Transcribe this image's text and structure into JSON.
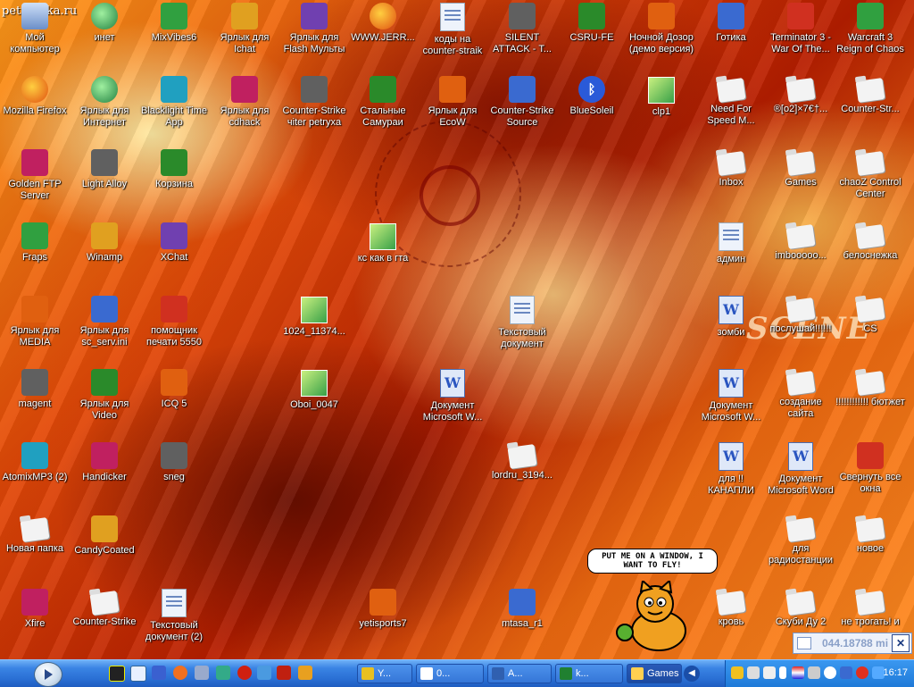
{
  "brand": "petryshka.ru",
  "wallpaper_text": "SCENE",
  "icons": [
    {
      "label": "Мой компьютер",
      "type": "computer"
    },
    {
      "label": "инет",
      "type": "net"
    },
    {
      "label": "MixVibes6",
      "type": "app"
    },
    {
      "label": "Ярлык для Ichat",
      "type": "app"
    },
    {
      "label": "Ярлык для Flash Мульты",
      "type": "app"
    },
    {
      "label": "WWW.JERR...",
      "type": "firefox"
    },
    {
      "label": "коды на counter-straik",
      "type": "doc"
    },
    {
      "label": "SILENT ATTACK - T...",
      "type": "app"
    },
    {
      "label": "CSRU-FE",
      "type": "app"
    },
    {
      "label": "Ночной Дозор (демо версия)",
      "type": "app"
    },
    {
      "label": "Готика",
      "type": "app"
    },
    {
      "label": "Terminator 3 - War Of The...",
      "type": "app"
    },
    {
      "label": "Warcraft 3 Reign of Chaos",
      "type": "app"
    },
    {
      "label": "Mozilla Firefox",
      "type": "firefox"
    },
    {
      "label": "Ярлык для Интернет",
      "type": "net"
    },
    {
      "label": "Blacklight Time App",
      "type": "app"
    },
    {
      "label": "Ярлык для cdhack",
      "type": "app"
    },
    {
      "label": "Counter-Strike чiter petryxa",
      "type": "app"
    },
    {
      "label": "Стальные Самураи",
      "type": "app"
    },
    {
      "label": "Ярлык для EcoW",
      "type": "app"
    },
    {
      "label": "Counter-Strike Source",
      "type": "app"
    },
    {
      "label": "BlueSoleil",
      "type": "bluetooth"
    },
    {
      "label": "clp1",
      "type": "img"
    },
    {
      "label": "Need For Speed M...",
      "type": "folder"
    },
    {
      "label": "®[o2]×7€†...",
      "type": "folder"
    },
    {
      "label": "Counter-Str...",
      "type": "folder"
    },
    {
      "label": "Golden FTP Server",
      "type": "app"
    },
    {
      "label": "Light Alloy",
      "type": "app"
    },
    {
      "label": "Корзина",
      "type": "app"
    },
    {
      "label": "Inbox",
      "type": "folder"
    },
    {
      "label": "Games",
      "type": "folder"
    },
    {
      "label": "chaoZ Control Center",
      "type": "folder"
    },
    {
      "label": "Fraps",
      "type": "app"
    },
    {
      "label": "Winamp",
      "type": "app"
    },
    {
      "label": "XChat",
      "type": "app"
    },
    {
      "label": "кс как в гта",
      "type": "img"
    },
    {
      "label": "админ",
      "type": "doc"
    },
    {
      "label": "imbooooo...",
      "type": "folder"
    },
    {
      "label": "белоснежка",
      "type": "folder"
    },
    {
      "label": "Ярлык для MEDIA",
      "type": "app"
    },
    {
      "label": "Ярлык для sc_serv.ini",
      "type": "app"
    },
    {
      "label": "помощник печати 5550",
      "type": "app"
    },
    {
      "label": "1024_11374...",
      "type": "img"
    },
    {
      "label": "Текстовый документ",
      "type": "doc"
    },
    {
      "label": "зомби",
      "type": "word"
    },
    {
      "label": "послушай!!!!!!",
      "type": "folder"
    },
    {
      "label": "CS",
      "type": "folder"
    },
    {
      "label": "magent",
      "type": "app"
    },
    {
      "label": "Ярлык для Video",
      "type": "app"
    },
    {
      "label": "ICQ 5",
      "type": "app"
    },
    {
      "label": "Oboi_0047",
      "type": "img"
    },
    {
      "label": "Документ Microsoft W...",
      "type": "word"
    },
    {
      "label": "Документ Microsoft W...",
      "type": "word"
    },
    {
      "label": "создание сайта",
      "type": "folder"
    },
    {
      "label": "!!!!!!!!!!!! бютжет",
      "type": "folder"
    },
    {
      "label": "AtomixMP3 (2)",
      "type": "app"
    },
    {
      "label": "Handicker",
      "type": "app"
    },
    {
      "label": "sneg",
      "type": "app"
    },
    {
      "label": "lordru_3194...",
      "type": "folder"
    },
    {
      "label": "для !! КАНАПЛИ",
      "type": "word"
    },
    {
      "label": "Документ Microsoft Word",
      "type": "word"
    },
    {
      "label": "Свернуть все окна",
      "type": "app"
    },
    {
      "label": "Новая папка",
      "type": "folder"
    },
    {
      "label": "CandyCoated",
      "type": "app"
    },
    {
      "label": "для радиостанции",
      "type": "folder"
    },
    {
      "label": "новое",
      "type": "folder"
    },
    {
      "label": "Xfire",
      "type": "app"
    },
    {
      "label": "Counter-Strike",
      "type": "folder"
    },
    {
      "label": "Текстовый документ (2)",
      "type": "doc"
    },
    {
      "label": "yetisports7",
      "type": "app"
    },
    {
      "label": "mtasa_r1",
      "type": "app"
    },
    {
      "label": "кровь",
      "type": "folder"
    },
    {
      "label": "Скуби Ду 2",
      "type": "folder"
    },
    {
      "label": "не трогать! и",
      "type": "folder"
    }
  ],
  "cat_bubble": "PUT ME ON A WINDOW, I WANT TO FLY!",
  "tray_popup": {
    "text": "044.18788 mi",
    "close": "✕"
  },
  "taskbar": {
    "tasks": [
      {
        "label": "Y...",
        "color": "#e8c020"
      },
      {
        "label": "0...",
        "color": "#ffffff"
      },
      {
        "label": "A...",
        "color": "#3060b0"
      },
      {
        "label": "k...",
        "color": "#208030"
      },
      {
        "label": "Games",
        "color": "#ffd050"
      }
    ],
    "clock": "16:17"
  }
}
